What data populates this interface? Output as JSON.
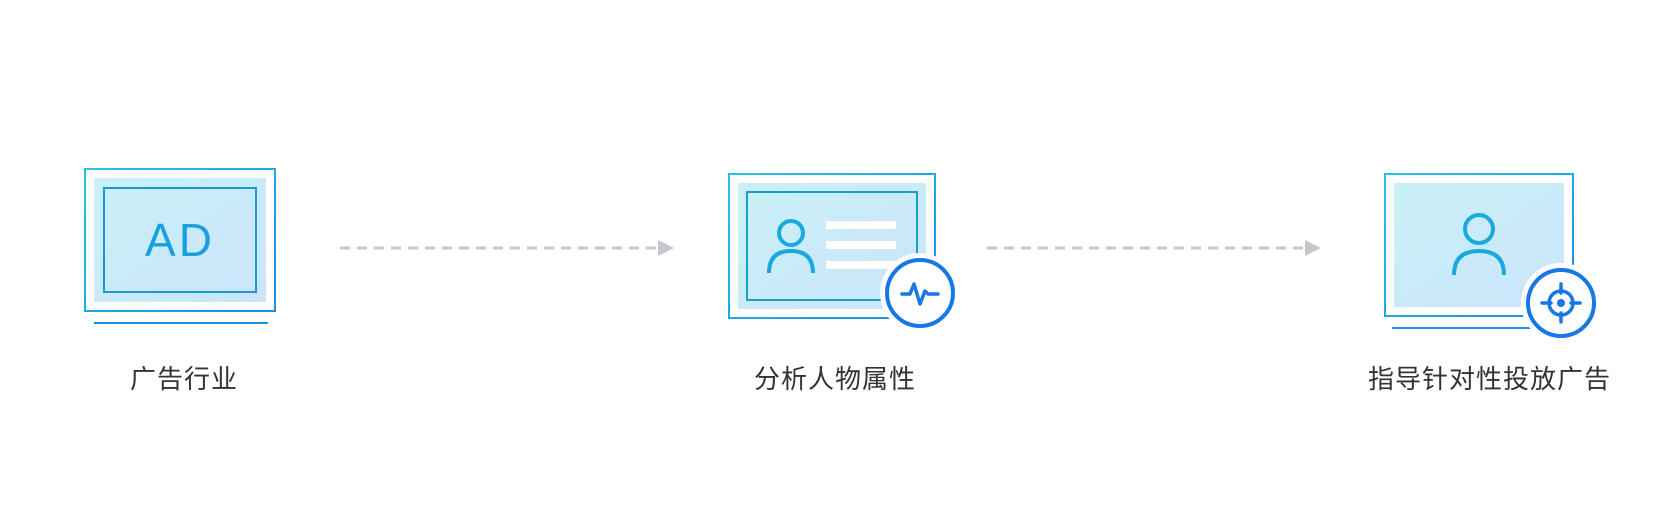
{
  "steps": [
    {
      "label": "广告行业",
      "icon": "ad-monitor-icon",
      "icon_text": "AD"
    },
    {
      "label": "分析人物属性",
      "icon": "profile-card-with-pulse-icon"
    },
    {
      "label": "指导针对性投放广告",
      "icon": "user-monitor-with-target-icon"
    }
  ],
  "connectors": [
    {
      "style": "dashed-arrow",
      "from": 0,
      "to": 1
    },
    {
      "style": "dashed-arrow",
      "from": 1,
      "to": 2
    }
  ],
  "colors": {
    "frame_light": "#27c3e3",
    "frame_dark": "#1a8fe0",
    "fill_start": "#c9f1f6",
    "fill_end": "#cce4fb",
    "accent_blue": "#1677e5",
    "arrow_gray": "#c4c7cc",
    "label_text": "#333333"
  }
}
